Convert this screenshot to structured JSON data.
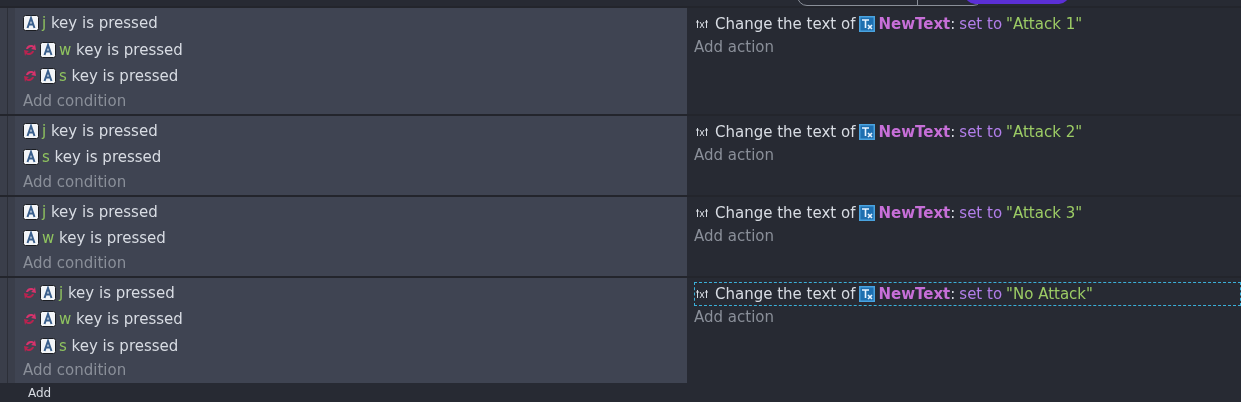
{
  "events": [
    {
      "conditions": [
        {
          "inverted": false,
          "key": "j",
          "text": "key is pressed"
        },
        {
          "inverted": true,
          "key": "w",
          "text": "key is pressed"
        },
        {
          "inverted": true,
          "key": "s",
          "text": "key is pressed"
        }
      ],
      "add_condition": "Add condition",
      "actions": [
        {
          "text": "Change the text of",
          "object": "NewText",
          "separator": ":",
          "operator": "set to",
          "value": "\"Attack 1\"",
          "selected": false
        }
      ],
      "add_action": "Add action"
    },
    {
      "conditions": [
        {
          "inverted": false,
          "key": "j",
          "text": "key is pressed"
        },
        {
          "inverted": false,
          "key": "s",
          "text": "key is pressed"
        }
      ],
      "add_condition": "Add condition",
      "actions": [
        {
          "text": "Change the text of",
          "object": "NewText",
          "separator": ":",
          "operator": "set to",
          "value": "\"Attack 2\"",
          "selected": false
        }
      ],
      "add_action": "Add action"
    },
    {
      "conditions": [
        {
          "inverted": false,
          "key": "j",
          "text": "key is pressed"
        },
        {
          "inverted": false,
          "key": "w",
          "text": "key is pressed"
        }
      ],
      "add_condition": "Add condition",
      "actions": [
        {
          "text": "Change the text of",
          "object": "NewText",
          "separator": ":",
          "operator": "set to",
          "value": "\"Attack 3\"",
          "selected": false
        }
      ],
      "add_action": "Add action"
    },
    {
      "conditions": [
        {
          "inverted": true,
          "key": "j",
          "text": "key is pressed"
        },
        {
          "inverted": true,
          "key": "w",
          "text": "key is pressed"
        },
        {
          "inverted": true,
          "key": "s",
          "text": "key is pressed"
        }
      ],
      "add_condition": "Add condition",
      "actions": [
        {
          "text": "Change the text of",
          "object": "NewText",
          "separator": ":",
          "operator": "set to",
          "value": "\"No Attack\"",
          "selected": true
        }
      ],
      "add_action": "Add action"
    }
  ],
  "footer": {
    "label": "Add"
  }
}
